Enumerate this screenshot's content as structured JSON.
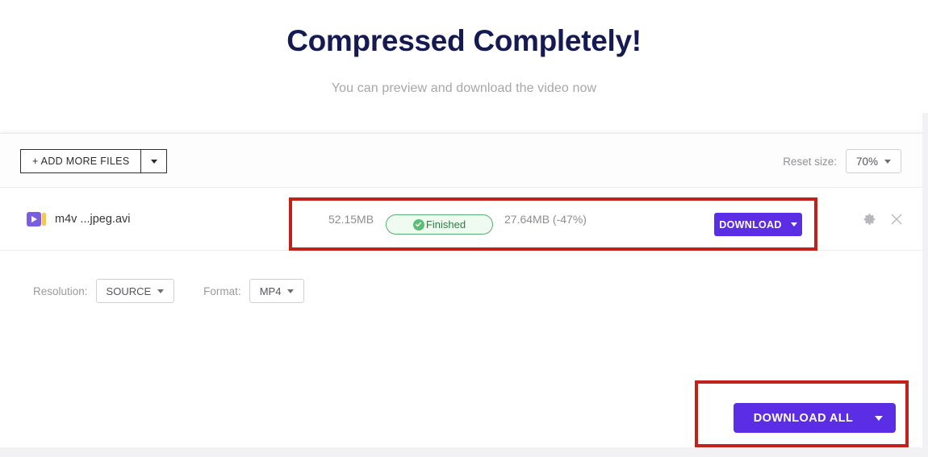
{
  "hero": {
    "title": "Compressed Completely!",
    "subtitle": "You can preview and download the video now",
    "title_color": "#151a52"
  },
  "toolbar": {
    "add_files_label": "+ ADD MORE FILES",
    "add_files_caret_icon": "chevron-down-icon",
    "reset_size_label": "Reset size:",
    "reset_size_value": "70%",
    "reset_size_caret_icon": "chevron-down-icon"
  },
  "file_row": {
    "file_icon": "video-file-icon",
    "file_name": "m4v ...jpeg.avi",
    "original_size": "52.15MB",
    "status": {
      "icon": "check-circle-icon",
      "label": "Finished",
      "text_color": "#2f7d45",
      "border_color": "#56b26e",
      "fill_color": "#effaf1"
    },
    "compressed_size": "27.64MB (-47%)",
    "download_label": "DOWNLOAD",
    "download_caret_icon": "chevron-down-icon",
    "download_color": "#5b2ee5",
    "settings_icon": "gear-icon",
    "remove_icon": "close-icon"
  },
  "footer": {
    "resolution_label": "Resolution:",
    "resolution_value": "SOURCE",
    "resolution_caret_icon": "chevron-down-icon",
    "format_label": "Format:",
    "format_value": "MP4",
    "format_caret_icon": "chevron-down-icon",
    "download_all_label": "DOWNLOAD ALL",
    "download_all_caret_icon": "chevron-down-icon",
    "download_all_color": "#5b2ee5"
  },
  "annotations": {
    "color": "#c2201b",
    "boxes": [
      "file-row-status-highlight",
      "download-all-highlight"
    ]
  }
}
